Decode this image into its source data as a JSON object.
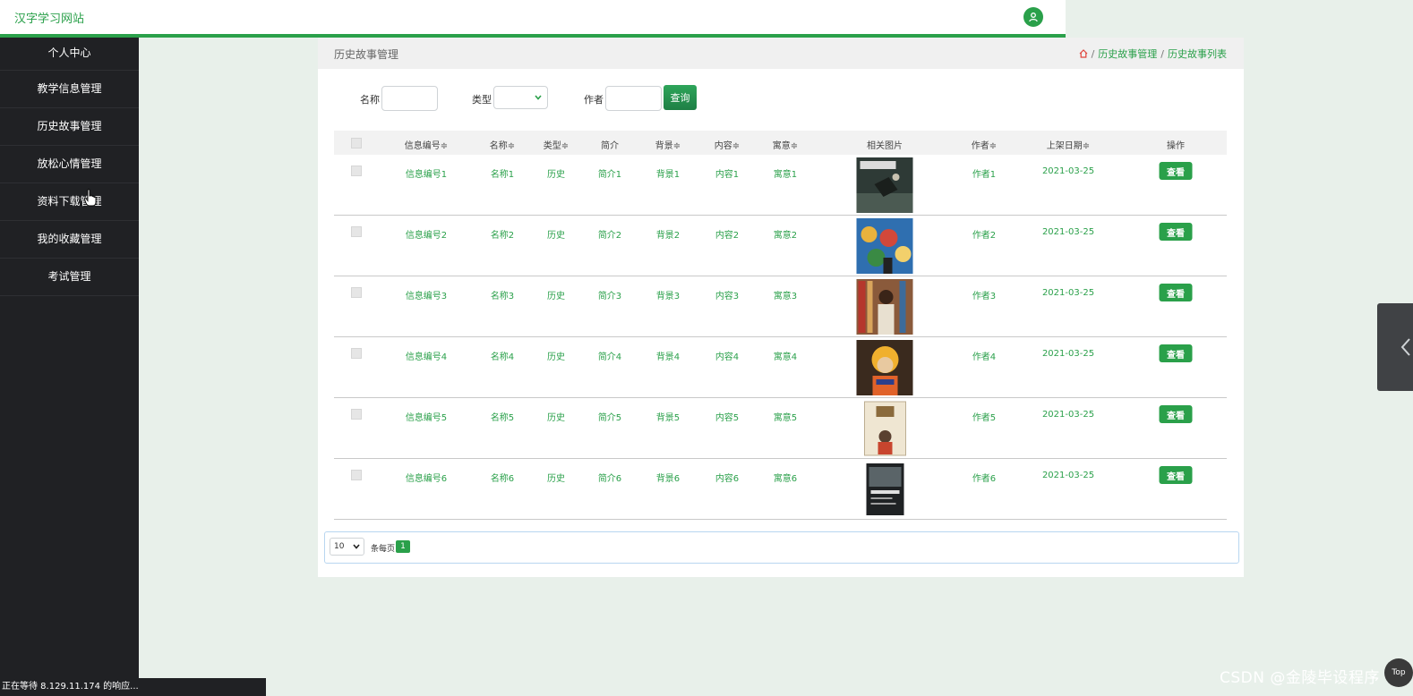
{
  "site": {
    "title": "汉字学习网站"
  },
  "sidebar": {
    "items": [
      {
        "label": "个人中心"
      },
      {
        "label": "教学信息管理"
      },
      {
        "label": "历史故事管理"
      },
      {
        "label": "放松心情管理"
      },
      {
        "label": "资料下载管理"
      },
      {
        "label": "我的收藏管理"
      },
      {
        "label": "考试管理"
      }
    ]
  },
  "panel": {
    "title": "历史故事管理"
  },
  "breadcrumb": {
    "items": [
      "历史故事管理",
      "历史故事列表"
    ],
    "separator": "/"
  },
  "search": {
    "name_label": "名称",
    "name_value": "",
    "type_label": "类型",
    "type_value": "",
    "author_label": "作者",
    "author_value": "",
    "button_label": "查询"
  },
  "table": {
    "headers": [
      "信息编号≑",
      "名称≑",
      "类型≑",
      "简介",
      "背景≑",
      "内容≑",
      "寓意≑",
      "相关图片",
      "作者≑",
      "上架日期≑",
      "操作"
    ],
    "rows": [
      {
        "id": "信息编号1",
        "name": "名称1",
        "type": "历史",
        "intro": "简介1",
        "background": "背景1",
        "content": "内容1",
        "moral": "寓意1",
        "author": "作者1",
        "date": "2021-03-25",
        "action": "查看"
      },
      {
        "id": "信息编号2",
        "name": "名称2",
        "type": "历史",
        "intro": "简介2",
        "background": "背景2",
        "content": "内容2",
        "moral": "寓意2",
        "author": "作者2",
        "date": "2021-03-25",
        "action": "查看"
      },
      {
        "id": "信息编号3",
        "name": "名称3",
        "type": "历史",
        "intro": "简介3",
        "background": "背景3",
        "content": "内容3",
        "moral": "寓意3",
        "author": "作者3",
        "date": "2021-03-25",
        "action": "查看"
      },
      {
        "id": "信息编号4",
        "name": "名称4",
        "type": "历史",
        "intro": "简介4",
        "background": "背景4",
        "content": "内容4",
        "moral": "寓意4",
        "author": "作者4",
        "date": "2021-03-25",
        "action": "查看"
      },
      {
        "id": "信息编号5",
        "name": "名称5",
        "type": "历史",
        "intro": "简介5",
        "background": "背景5",
        "content": "内容5",
        "moral": "寓意5",
        "author": "作者5",
        "date": "2021-03-25",
        "action": "查看"
      },
      {
        "id": "信息编号6",
        "name": "名称6",
        "type": "历史",
        "intro": "简介6",
        "background": "背景6",
        "content": "内容6",
        "moral": "寓意6",
        "author": "作者6",
        "date": "2021-03-25",
        "action": "查看"
      }
    ]
  },
  "pagination": {
    "page_size": "10",
    "per_page_label": "条每页",
    "current_page": "1"
  },
  "status_bar": {
    "text": "正在等待 8.129.11.174 的响应..."
  },
  "watermark": {
    "text": "CSDN @金陵毕设程序"
  },
  "back_to_top": {
    "label": "Top"
  },
  "colors": {
    "accent": "#2aa04a",
    "sidebar_bg": "#202124",
    "page_bg": "#e8f0ea"
  }
}
